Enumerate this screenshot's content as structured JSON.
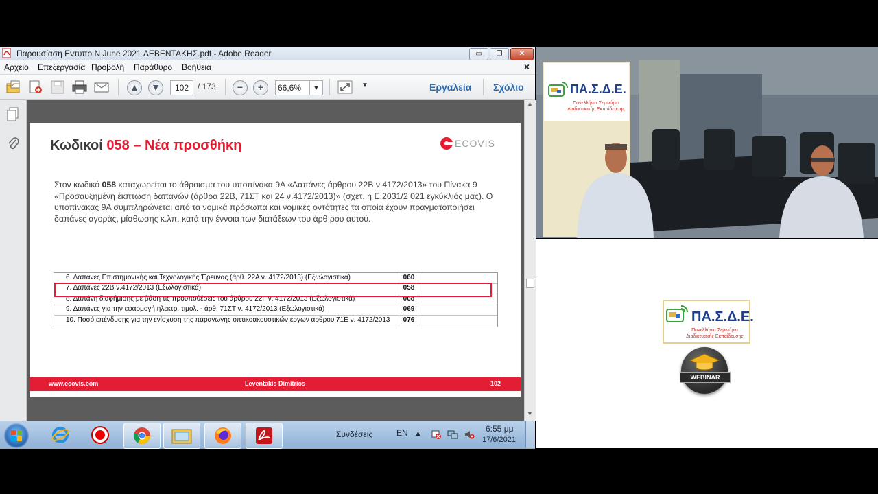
{
  "window": {
    "title": "Παρουσίαση Εντυπο Ν June 2021 ΛΕΒΕΝΤΑΚΗΣ.pdf - Adobe Reader",
    "minimize": "▭",
    "maximize": "❐",
    "close": "✕"
  },
  "menu": {
    "items": [
      "Αρχείο",
      "Επεξεργασία",
      "Προβολή",
      "Παράθυρο",
      "Βοήθεια"
    ],
    "close_doc": "×"
  },
  "toolbar": {
    "page_current": "102",
    "page_total": "/ 173",
    "zoom": "66,6%",
    "tools_label": "Εργαλεία",
    "comment_label": "Σχόλιο"
  },
  "slide": {
    "title_prefix": "Κωδικοί ",
    "title_code": "058",
    "title_rest": " – Νέα προσθήκη",
    "brand": "ECOVIS",
    "paragraph_pre": "Στον κωδικό ",
    "paragraph_code": "058",
    "paragraph_post": " καταχωρείται το άθροισμα του υποπίνακα 9Α «Δαπάνες άρθρου 22Β ν.4172/2013» του Πίνακα 9 «Προσαυξημένη έκπτωση δαπανών (άρθρα 22Β, 71ΣΤ και 24 ν.4172/2013)» (σχετ. η Ε.2031/2 021 εγκύκλιός μας). Ο υποπίνακας 9Α συμπληρώνεται από τα νομικά πρόσωπα και νομικές οντότητες τα οποία έχουν πραγματοποιήσει δαπάνες αγοράς, μίσθωσης κ.λπ. κατά την έννοια των διατάξεων του άρθ ρου αυτού.",
    "table": [
      {
        "label": "6.  Δαπάνες Επιστημονικής και Τεχνολογικής Έρευνας (άρθ. 22Α ν. 4172/2013) (Εξωλογιστικά)",
        "code": "060"
      },
      {
        "label": "7.  Δαπάνες 22Β ν.4172/2013 (Εξωλογιστικά)",
        "code": "058"
      },
      {
        "label": "8.  Δαπάνη διαφήμισης με βάση τις προϋποθέσεις του άρθρου 22Γ ν. 4172/2013 (Εξωλογιστικά)",
        "code": "068"
      },
      {
        "label": "9.  Δαπάνες για την εφαρμογή ηλεκτρ. τιμολ. - άρθ. 71ΣΤ ν. 4172/2013 (Εξωλογιστικά)",
        "code": "069"
      },
      {
        "label": "10.  Ποσό επένδυσης για την ενίσχυση της παραγωγής οπτικοακουστικών έργων άρθρου 71Ε ν. 4172/2013",
        "code": "076"
      }
    ],
    "highlighted_row": 1,
    "footer_left": "www.ecovis.com",
    "footer_center": "Leventakis Dimitrios",
    "footer_right": "102",
    "accent_color": "#e31d33"
  },
  "taskbar": {
    "sync_label": "Συνδέσεις",
    "lang": "EN",
    "time": "6:55 μμ",
    "date": "17/6/2021",
    "apps": [
      "start-orb",
      "internet-explorer-icon",
      "recorder-icon",
      "chrome-icon",
      "file-explorer-icon",
      "firefox-icon",
      "adobe-reader-icon"
    ]
  },
  "branding": {
    "name": "ΠΑ.Σ.Δ.Ε.",
    "subtitle1": "Πανελλήνια Σεμινάρια",
    "subtitle2": "Διαδικτυακής Εκπαίδευσης",
    "webinar": "WEBINAR"
  }
}
